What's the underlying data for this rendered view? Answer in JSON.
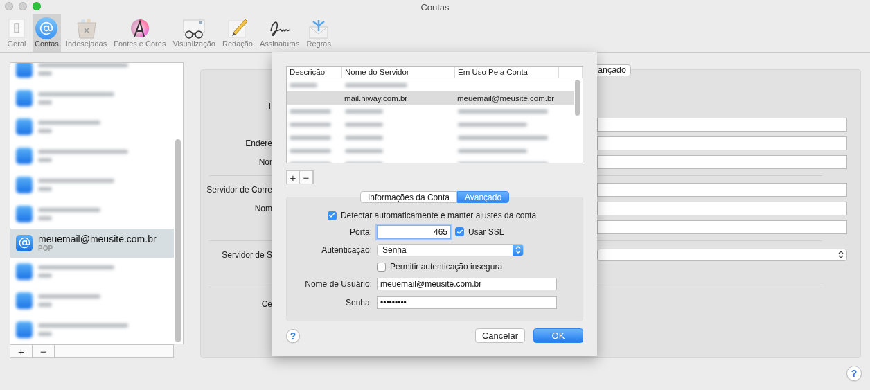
{
  "window": {
    "title": "Contas"
  },
  "toolbar": [
    {
      "label": "Geral",
      "kind": "general",
      "selected": false
    },
    {
      "label": "Contas",
      "kind": "accounts",
      "selected": true
    },
    {
      "label": "Indesejadas",
      "kind": "junk",
      "selected": false
    },
    {
      "label": "Fontes e Cores",
      "kind": "fonts",
      "selected": false
    },
    {
      "label": "Visualização",
      "kind": "viewing",
      "selected": false
    },
    {
      "label": "Redação",
      "kind": "compose",
      "selected": false
    },
    {
      "label": "Assinaturas",
      "kind": "signature",
      "selected": false
    },
    {
      "label": "Regras",
      "kind": "rules",
      "selected": false
    }
  ],
  "accounts": [
    {
      "kind": "blurred",
      "selected": false
    },
    {
      "kind": "blurred",
      "selected": false
    },
    {
      "kind": "blurred",
      "selected": false
    },
    {
      "kind": "blurred",
      "selected": false
    },
    {
      "kind": "blurred",
      "selected": false
    },
    {
      "kind": "blurred",
      "selected": false
    },
    {
      "kind": "account",
      "name": "meuemail@meusite.com.br",
      "type": "POP",
      "selected": true
    },
    {
      "kind": "blurred",
      "selected": false
    },
    {
      "kind": "blurred",
      "selected": false
    },
    {
      "kind": "blurred",
      "selected": false
    }
  ],
  "account_list_buttons": [
    "+",
    "−"
  ],
  "detail": {
    "tab": "ançado",
    "rows": [
      {
        "kind": "text",
        "label": "T"
      },
      {
        "kind": "field"
      },
      {
        "kind": "field",
        "label": "Endere"
      },
      {
        "kind": "field",
        "label": "Nor"
      },
      {
        "kind": "separator"
      },
      {
        "kind": "field",
        "label": "Servidor de Corre"
      },
      {
        "kind": "field",
        "label": "Nom"
      },
      {
        "kind": "field"
      },
      {
        "kind": "separator"
      },
      {
        "kind": "select",
        "label": "Servidor de S"
      },
      {
        "kind": "separator"
      },
      {
        "kind": "text",
        "label": "Ce"
      }
    ]
  },
  "help": "?",
  "sheet": {
    "server_table": {
      "columns": [
        "Descrição",
        "Nome do Servidor",
        "Em Uso Pela Conta"
      ],
      "rows": [
        {
          "kind": "blurred",
          "selected": false
        },
        {
          "kind": "server",
          "server": "mail.hiway.com.br",
          "account": "meuemail@meusite.com.br",
          "selected": true
        },
        {
          "kind": "blurred",
          "selected": false
        },
        {
          "kind": "blurred",
          "selected": false
        },
        {
          "kind": "blurred",
          "selected": false
        },
        {
          "kind": "blurred",
          "selected": false
        },
        {
          "kind": "blurred",
          "selected": false
        }
      ]
    },
    "table_buttons": [
      "+",
      "−"
    ],
    "tabs": [
      {
        "label": "Informações da Conta",
        "selected": false
      },
      {
        "label": "Avançado",
        "selected": true
      }
    ],
    "auto_detect": {
      "label": "Detectar automaticamente e manter ajustes da conta",
      "checked": true
    },
    "port": {
      "label": "Porta:",
      "value": "465"
    },
    "ssl": {
      "label": "Usar SSL",
      "checked": true
    },
    "authentication": {
      "label": "Autenticação:",
      "value": "Senha"
    },
    "allow_insecure": {
      "label": "Permitir autenticação insegura",
      "checked": false
    },
    "username": {
      "label": "Nome de Usuário:",
      "value": "meuemail@meusite.com.br"
    },
    "password": {
      "label": "Senha:",
      "value": "•••••••••"
    },
    "help": "?",
    "buttons": [
      {
        "label": "Cancelar",
        "kind": "secondary"
      },
      {
        "label": "OK",
        "kind": "primary"
      }
    ]
  }
}
